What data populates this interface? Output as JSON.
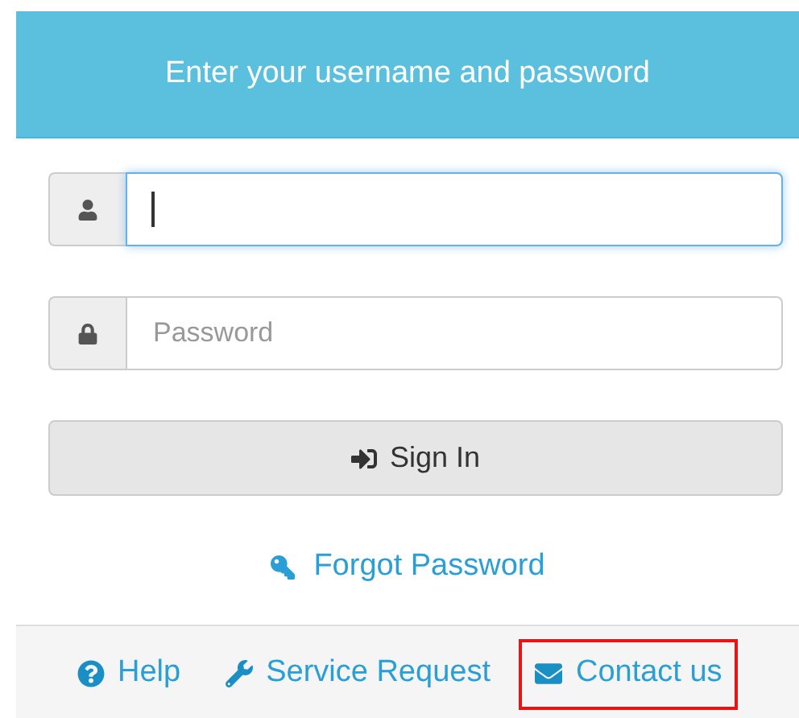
{
  "header": {
    "title": "Enter your username and password"
  },
  "fields": [
    {
      "kind": "user",
      "focused": true
    },
    {
      "kind": "lock",
      "placeholder": "Password",
      "focused": false
    }
  ],
  "sign_in": {
    "label": "Sign In"
  },
  "forgot": {
    "label": "Forgot Password"
  },
  "footer_links": [
    {
      "kind": "help",
      "label": "Help",
      "highlighted": false
    },
    {
      "kind": "wrench",
      "label": "Service Request",
      "highlighted": false
    },
    {
      "kind": "mail",
      "label": "Contact us",
      "highlighted": true
    }
  ]
}
